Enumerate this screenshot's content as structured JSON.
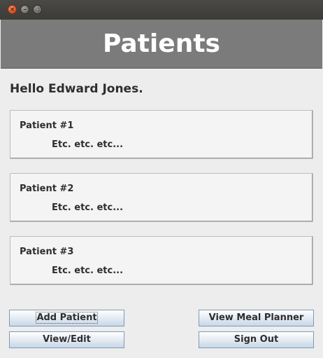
{
  "window": {
    "controls": {
      "close_icon": "close-icon",
      "minimize_icon": "minimize-icon",
      "maximize_icon": "maximize-icon"
    }
  },
  "header": {
    "title": "Patients"
  },
  "greeting": "Hello Edward Jones.",
  "patients": [
    {
      "title": "Patient #1",
      "details": "Etc. etc. etc..."
    },
    {
      "title": "Patient #2",
      "details": "Etc. etc. etc..."
    },
    {
      "title": "Patient #3",
      "details": "Etc. etc. etc..."
    }
  ],
  "buttons": {
    "add_patient": "Add Patient",
    "view_meal_planner": "View Meal Planner",
    "view_edit": "View/Edit",
    "sign_out": "Sign Out"
  },
  "colors": {
    "header_bg": "#7b7b7b",
    "window_bg": "#ededed",
    "titlebar_bg": "#3c3b37"
  }
}
